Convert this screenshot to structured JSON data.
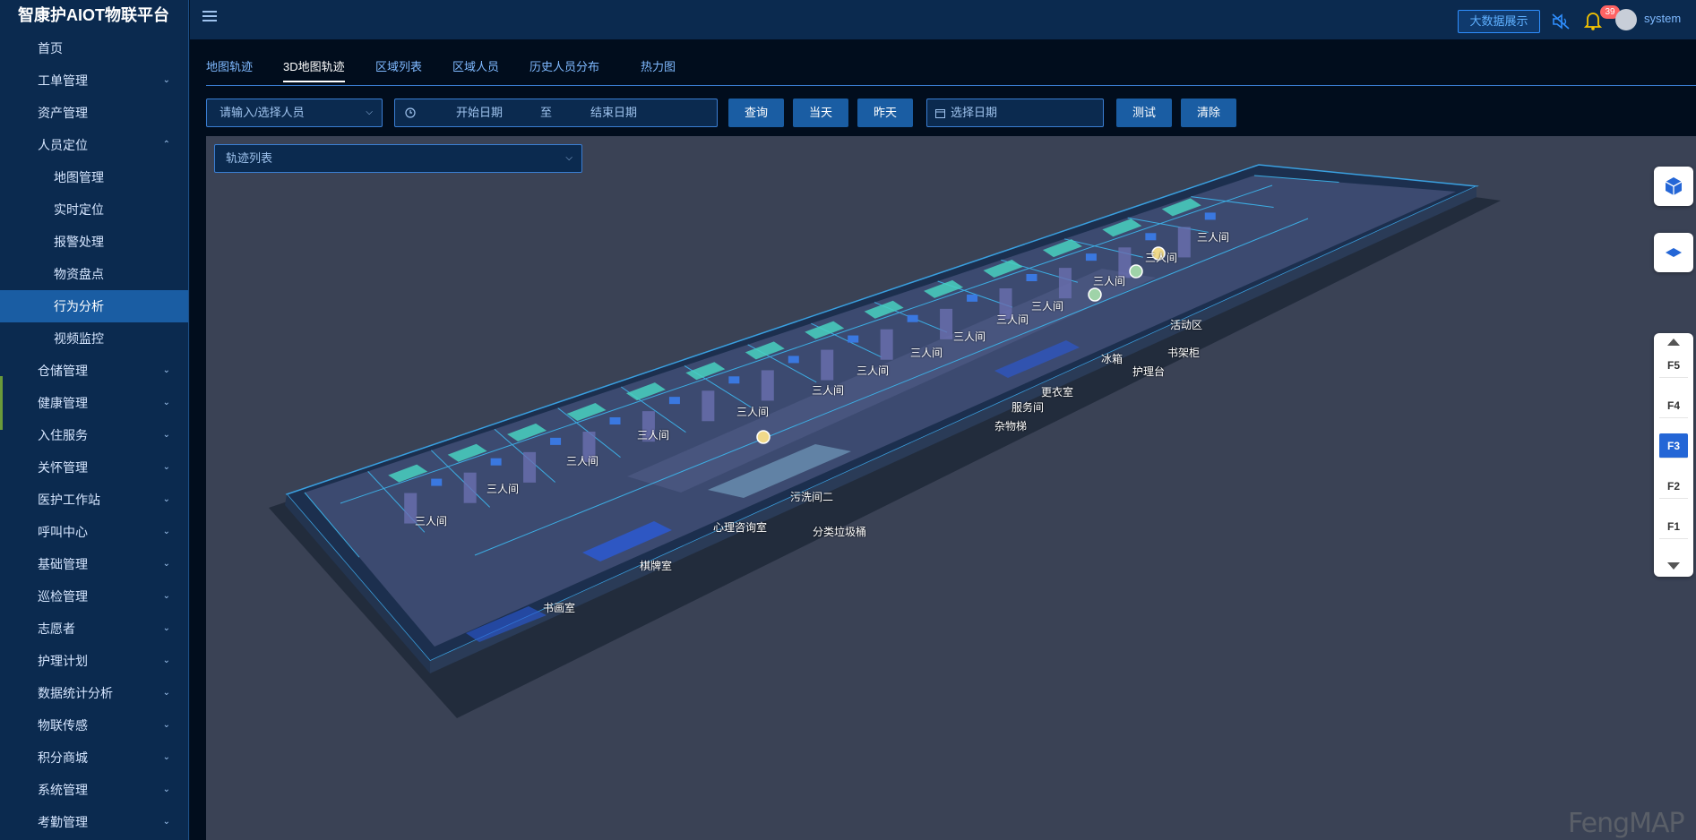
{
  "app": {
    "title": "智康护AIOT物联平台",
    "username": "system",
    "bigdata_label": "大数据展示",
    "notification_count": "39"
  },
  "sidebar": {
    "items": [
      {
        "label": "首页",
        "level": 1,
        "expandable": false,
        "chevron": ""
      },
      {
        "label": "工单管理",
        "level": 1,
        "expandable": true,
        "chevron": "⌄"
      },
      {
        "label": "资产管理",
        "level": 1,
        "expandable": false,
        "chevron": ""
      },
      {
        "label": "人员定位",
        "level": 1,
        "expandable": true,
        "chevron": "⌃"
      },
      {
        "label": "地图管理",
        "level": 2,
        "expandable": false,
        "chevron": ""
      },
      {
        "label": "实时定位",
        "level": 2,
        "expandable": false,
        "chevron": ""
      },
      {
        "label": "报警处理",
        "level": 2,
        "expandable": false,
        "chevron": ""
      },
      {
        "label": "物资盘点",
        "level": 2,
        "expandable": false,
        "chevron": ""
      },
      {
        "label": "行为分析",
        "level": 2,
        "expandable": false,
        "active": true,
        "chevron": ""
      },
      {
        "label": "视频监控",
        "level": 2,
        "expandable": false,
        "chevron": ""
      },
      {
        "label": "仓储管理",
        "level": 1,
        "expandable": true,
        "chevron": "⌄"
      },
      {
        "label": "健康管理",
        "level": 1,
        "expandable": true,
        "chevron": "⌄"
      },
      {
        "label": "入住服务",
        "level": 1,
        "expandable": true,
        "chevron": "⌄"
      },
      {
        "label": "关怀管理",
        "level": 1,
        "expandable": true,
        "chevron": "⌄"
      },
      {
        "label": "医护工作站",
        "level": 1,
        "expandable": true,
        "chevron": "⌄"
      },
      {
        "label": "呼叫中心",
        "level": 1,
        "expandable": true,
        "chevron": "⌄"
      },
      {
        "label": "基础管理",
        "level": 1,
        "expandable": true,
        "chevron": "⌄"
      },
      {
        "label": "巡检管理",
        "level": 1,
        "expandable": true,
        "chevron": "⌄"
      },
      {
        "label": "志愿者",
        "level": 1,
        "expandable": true,
        "chevron": "⌄"
      },
      {
        "label": "护理计划",
        "level": 1,
        "expandable": true,
        "chevron": "⌄"
      },
      {
        "label": "数据统计分析",
        "level": 1,
        "expandable": true,
        "chevron": "⌄"
      },
      {
        "label": "物联传感",
        "level": 1,
        "expandable": true,
        "chevron": "⌄"
      },
      {
        "label": "积分商城",
        "level": 1,
        "expandable": true,
        "chevron": "⌄"
      },
      {
        "label": "系统管理",
        "level": 1,
        "expandable": true,
        "chevron": "⌄"
      },
      {
        "label": "考勤管理",
        "level": 1,
        "expandable": true,
        "chevron": "⌄"
      }
    ]
  },
  "tabs": [
    {
      "label": "地图轨迹",
      "active": false
    },
    {
      "label": "3D地图轨迹",
      "active": true
    },
    {
      "label": "区域列表",
      "active": false
    },
    {
      "label": "区域人员",
      "active": false
    },
    {
      "label": "历史人员分布",
      "active": false
    },
    {
      "label": "热力图",
      "active": false
    }
  ],
  "filters": {
    "person_placeholder": "请输入/选择人员",
    "start_date_placeholder": "开始日期",
    "range_separator": "至",
    "end_date_placeholder": "结束日期",
    "query_label": "查询",
    "today_label": "当天",
    "yesterday_label": "昨天",
    "date_placeholder": "选择日期",
    "test_label": "测试",
    "clear_label": "清除"
  },
  "map": {
    "track_list_placeholder": "轨迹列表",
    "watermark": "FengMAP",
    "rooms": [
      "三人间",
      "三人间",
      "三人间",
      "三人间",
      "三人间",
      "三人间",
      "三人间",
      "三人间",
      "三人间",
      "三人间",
      "三人间",
      "三人间",
      "三人间",
      "三人间",
      "活动区",
      "书架柜",
      "冰箱",
      "护理台",
      "更衣室",
      "服务间",
      "杂物梯",
      "污洗间二",
      "心理咨询室",
      "分类垃圾桶",
      "棋牌室",
      "书画室"
    ],
    "floors": [
      "F5",
      "F4",
      "F3",
      "F2",
      "F1"
    ],
    "active_floor": "F3"
  },
  "colors": {
    "sidebar_bg": "#0b2a4f",
    "active_item": "#1a5da3",
    "accent": "#3a7ed3",
    "map_bg": "#3a4255",
    "floor_active": "#2466d6"
  }
}
